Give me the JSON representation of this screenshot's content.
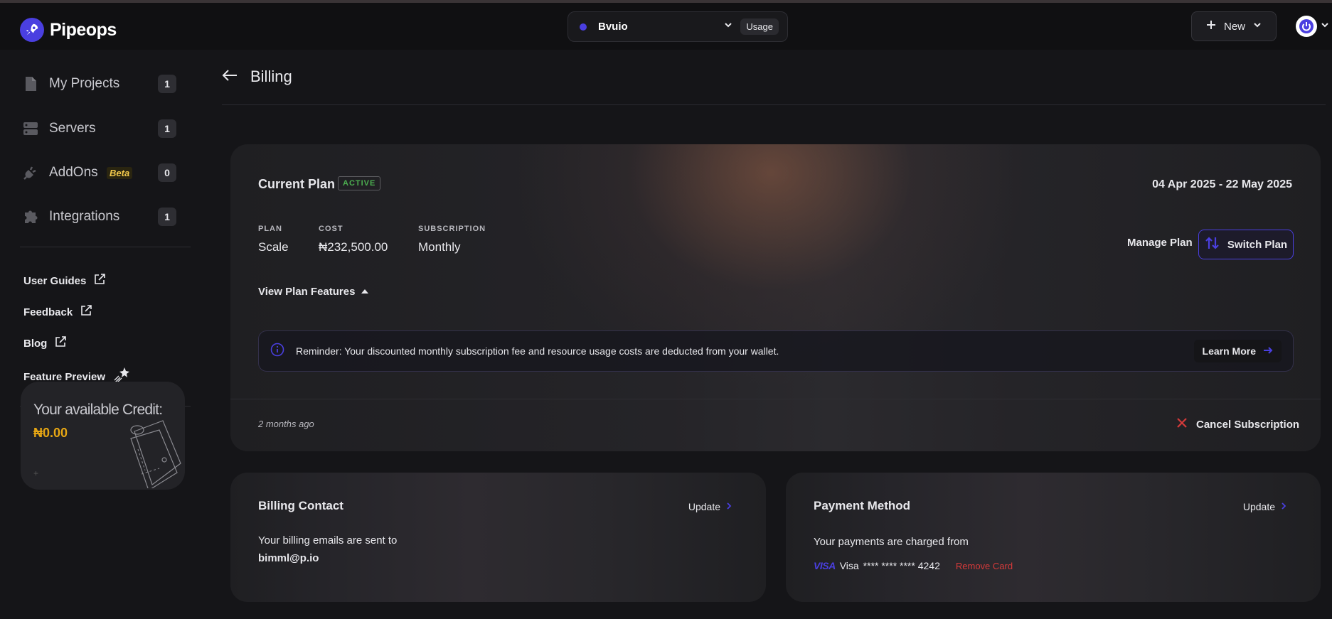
{
  "brand": {
    "name": "Pipeops"
  },
  "topbar": {
    "project_name": "Bvuio",
    "usage_label": "Usage",
    "new_label": "New"
  },
  "sidebar": {
    "items": [
      {
        "label": "My Projects",
        "count": "1",
        "icon": "file-icon"
      },
      {
        "label": "Servers",
        "count": "1",
        "icon": "server-icon"
      },
      {
        "label": "AddOns",
        "badge": "Beta",
        "count": "0",
        "icon": "plug-icon"
      },
      {
        "label": "Integrations",
        "count": "1",
        "icon": "puzzle-icon"
      }
    ],
    "links": [
      {
        "label": "User Guides",
        "icon": "external-link-icon"
      },
      {
        "label": "Feedback",
        "icon": "external-link-icon"
      },
      {
        "label": "Blog",
        "icon": "external-link-icon"
      },
      {
        "label": "Feature Preview",
        "icon": "sparkle-icon"
      }
    ],
    "credit": {
      "title": "Your available Credit:",
      "amount": "₦0.00",
      "plus": "+"
    }
  },
  "page": {
    "title": "Billing"
  },
  "plan": {
    "title": "Current Plan",
    "status": "ACTIVE",
    "dates": "04 Apr 2025 - 22 May 2025",
    "fields": [
      {
        "key": "PLAN",
        "value": "Scale"
      },
      {
        "key": "COST",
        "value": "₦232,500.00"
      },
      {
        "key": "SUBSCRIPTION",
        "value": "Monthly"
      }
    ],
    "manage_label": "Manage Plan",
    "switch_label": "Switch Plan",
    "view_features_label": "View Plan Features",
    "reminder": "Reminder: Your discounted monthly subscription fee and resource usage costs are deducted from your wallet.",
    "learn_more": "Learn More",
    "updated_ago": "2 months ago",
    "cancel_label": "Cancel Subscription"
  },
  "billing_contact": {
    "title": "Billing Contact",
    "update_label": "Update",
    "text": "Your billing emails are sent to",
    "email": "bimml@p.io"
  },
  "payment_method": {
    "title": "Payment Method",
    "update_label": "Update",
    "text": "Your payments are charged from",
    "card_logo": "VISA",
    "card_brand": "Visa",
    "card_number": "**** **** **** 4242",
    "remove_label": "Remove Card"
  },
  "colors": {
    "accent": "#4a3fe0",
    "credit": "#e6a614",
    "active": "#4caf50",
    "danger": "#d63a3a",
    "beta": "#f2c94c"
  }
}
